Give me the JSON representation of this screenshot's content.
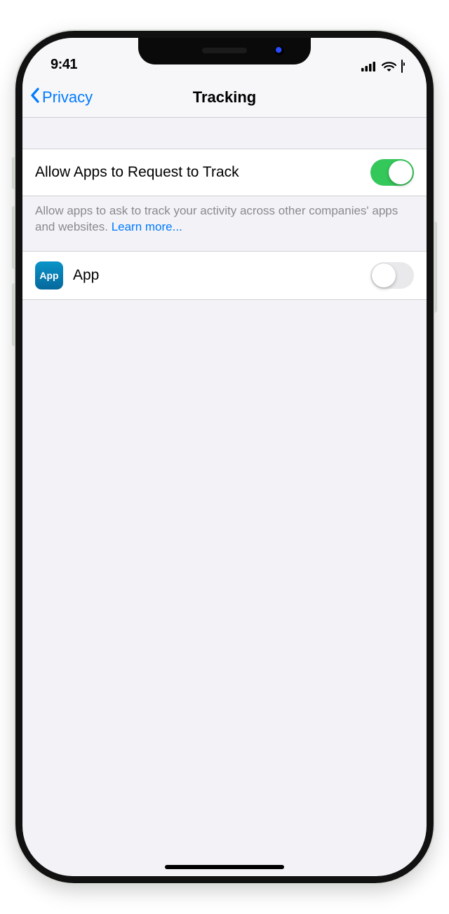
{
  "status_bar": {
    "time": "9:41"
  },
  "nav": {
    "back_label": "Privacy",
    "title": "Tracking"
  },
  "settings": {
    "allow_request_label": "Allow Apps to Request to Track",
    "allow_request_on": true,
    "footer_text": "Allow apps to ask to track your activity across other companies' apps and websites. ",
    "learn_more_label": "Learn more..."
  },
  "apps": [
    {
      "icon_text": "App",
      "name": "App",
      "tracking_on": false
    }
  ]
}
